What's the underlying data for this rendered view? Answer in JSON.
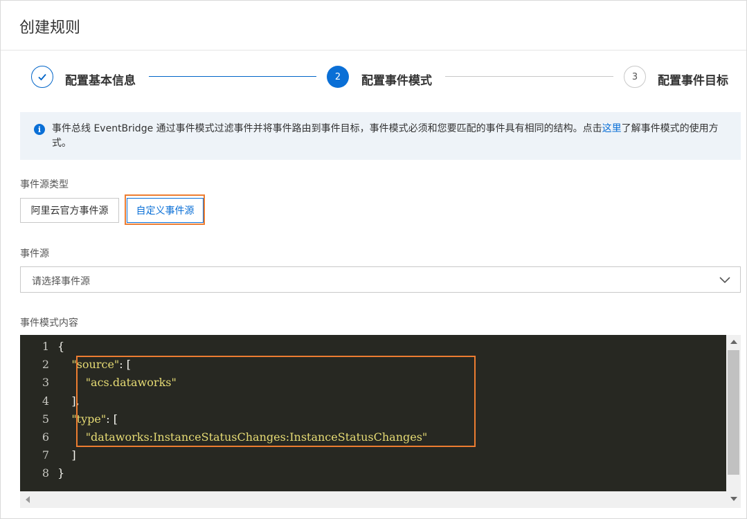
{
  "page": {
    "title": "创建规则"
  },
  "steps": [
    {
      "number": "1",
      "label": "配置基本信息",
      "state": "done"
    },
    {
      "number": "2",
      "label": "配置事件模式",
      "state": "active"
    },
    {
      "number": "3",
      "label": "配置事件目标",
      "state": "pending"
    }
  ],
  "notice": {
    "text_before": "事件总线 EventBridge 通过事件模式过滤事件并将事件路由到事件目标，事件模式必须和您要匹配的事件具有相同的结构。点击",
    "link": "这里",
    "text_after": "了解事件模式的使用方式。"
  },
  "event_source_type": {
    "label": "事件源类型",
    "options": [
      "阿里云官方事件源",
      "自定义事件源"
    ],
    "selected": "自定义事件源"
  },
  "event_source": {
    "label": "事件源",
    "placeholder": "请选择事件源"
  },
  "event_pattern": {
    "label": "事件模式内容",
    "line_numbers": [
      "1",
      "2",
      "3",
      "4",
      "5",
      "6",
      "7",
      "8"
    ],
    "lines": [
      {
        "indent": "",
        "key": "",
        "text": "{"
      },
      {
        "indent": "    ",
        "key": "\"source\"",
        "text": ": ["
      },
      {
        "indent": "        ",
        "key": "\"acs.dataworks\"",
        "text": ""
      },
      {
        "indent": "    ",
        "key": "",
        "text": "],"
      },
      {
        "indent": "    ",
        "key": "\"type\"",
        "text": ": ["
      },
      {
        "indent": "        ",
        "key": "\"dataworks:InstanceStatusChanges:InstanceStatusChanges\"",
        "text": ""
      },
      {
        "indent": "    ",
        "key": "",
        "text": "]"
      },
      {
        "indent": "",
        "key": "",
        "text": "}"
      }
    ]
  },
  "colors": {
    "accent": "#0a6fd6",
    "highlight": "#ed7d31",
    "editor_bg": "#272822",
    "string": "#e6db74"
  }
}
